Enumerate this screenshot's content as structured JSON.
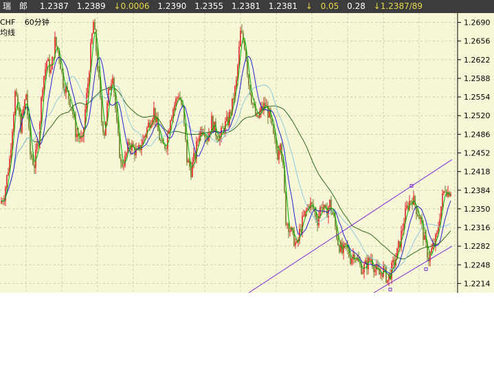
{
  "quote_bar": {
    "symbol": "瑞　郎",
    "last": "1.2387",
    "ask": "1.2389",
    "change": "↓0.0006",
    "open": "1.2390",
    "low": "1.2355",
    "high": "1.2381",
    "prev": "1.2381",
    "arrow": "↓",
    "volume": "0.05",
    "ratio": "0.28",
    "range_text": "↓1.2387/89"
  },
  "chart_header": {
    "symbol": "CHF",
    "period": "60分钟",
    "line_label": "均线"
  },
  "colors": {
    "background": "#f7f7d8",
    "grid": "#c9cfa5",
    "up_candle": "#e02020",
    "down_candle": "#6b7d1f",
    "ma_fast": "#00b000",
    "ma_mid": "#2020cc",
    "ma_light": "#8ec8dc",
    "ma_slow": "#2e6a1a",
    "channel": "#7a2ad8",
    "axis_text": "#000000"
  },
  "chart_data": {
    "type": "candlestick",
    "ylim": [
      1.2197,
      1.2707
    ],
    "y_ticks": [
      "1.2690",
      "1.2656",
      "1.2622",
      "1.2588",
      "1.2554",
      "1.2520",
      "1.2486",
      "1.2452",
      "1.2418",
      "1.2384",
      "1.2350",
      "1.2316",
      "1.2282",
      "1.2248",
      "1.2214"
    ],
    "close_path": [
      [
        0,
        1.236
      ],
      [
        6,
        1.2375
      ],
      [
        14,
        1.244
      ],
      [
        22,
        1.256
      ],
      [
        30,
        1.25
      ],
      [
        38,
        1.256
      ],
      [
        44,
        1.245
      ],
      [
        50,
        1.243
      ],
      [
        56,
        1.248
      ],
      [
        62,
        1.258
      ],
      [
        68,
        1.262
      ],
      [
        74,
        1.26
      ],
      [
        80,
        1.2655
      ],
      [
        86,
        1.263
      ],
      [
        92,
        1.258
      ],
      [
        98,
        1.256
      ],
      [
        104,
        1.254
      ],
      [
        110,
        1.249
      ],
      [
        116,
        1.248
      ],
      [
        120,
        1.247
      ],
      [
        124,
        1.253
      ],
      [
        128,
        1.258
      ],
      [
        132,
        1.264
      ],
      [
        136,
        1.269
      ],
      [
        140,
        1.264
      ],
      [
        144,
        1.258
      ],
      [
        148,
        1.251
      ],
      [
        152,
        1.249
      ],
      [
        158,
        1.256
      ],
      [
        164,
        1.26
      ],
      [
        170,
        1.25
      ],
      [
        176,
        1.243
      ],
      [
        182,
        1.244
      ],
      [
        188,
        1.247
      ],
      [
        194,
        1.246
      ],
      [
        200,
        1.245
      ],
      [
        206,
        1.247
      ],
      [
        212,
        1.249
      ],
      [
        218,
        1.251
      ],
      [
        224,
        1.253
      ],
      [
        230,
        1.249
      ],
      [
        236,
        1.246
      ],
      [
        242,
        1.247
      ],
      [
        248,
        1.252
      ],
      [
        254,
        1.254
      ],
      [
        260,
        1.256
      ],
      [
        266,
        1.253
      ],
      [
        272,
        1.244
      ],
      [
        278,
        1.242
      ],
      [
        284,
        1.245
      ],
      [
        290,
        1.249
      ],
      [
        296,
        1.25
      ],
      [
        302,
        1.248
      ],
      [
        308,
        1.251
      ],
      [
        314,
        1.249
      ],
      [
        320,
        1.248
      ],
      [
        326,
        1.25
      ],
      [
        332,
        1.251
      ],
      [
        338,
        1.254
      ],
      [
        344,
        1.258
      ],
      [
        350,
        1.267
      ],
      [
        356,
        1.265
      ],
      [
        362,
        1.258
      ],
      [
        368,
        1.254
      ],
      [
        374,
        1.251
      ],
      [
        380,
        1.253
      ],
      [
        386,
        1.254
      ],
      [
        392,
        1.252
      ],
      [
        398,
        1.248
      ],
      [
        404,
        1.245
      ],
      [
        408,
        1.248
      ],
      [
        412,
        1.242
      ],
      [
        416,
        1.233
      ],
      [
        420,
        1.232
      ],
      [
        426,
        1.23
      ],
      [
        432,
        1.228
      ],
      [
        438,
        1.232
      ],
      [
        444,
        1.234
      ],
      [
        450,
        1.236
      ],
      [
        456,
        1.235
      ],
      [
        462,
        1.233
      ],
      [
        468,
        1.236
      ],
      [
        474,
        1.234
      ],
      [
        480,
        1.236
      ],
      [
        486,
        1.233
      ],
      [
        492,
        1.229
      ],
      [
        498,
        1.227
      ],
      [
        504,
        1.228
      ],
      [
        510,
        1.226
      ],
      [
        516,
        1.227
      ],
      [
        522,
        1.225
      ],
      [
        528,
        1.224
      ],
      [
        534,
        1.225
      ],
      [
        540,
        1.226
      ],
      [
        546,
        1.224
      ],
      [
        552,
        1.223
      ],
      [
        558,
        1.224
      ],
      [
        564,
        1.222
      ],
      [
        570,
        1.224
      ],
      [
        576,
        1.226
      ],
      [
        582,
        1.229
      ],
      [
        588,
        1.233
      ],
      [
        594,
        1.236
      ],
      [
        600,
        1.237
      ],
      [
        606,
        1.235
      ],
      [
        612,
        1.233
      ],
      [
        618,
        1.229
      ],
      [
        624,
        1.226
      ],
      [
        630,
        1.228
      ],
      [
        636,
        1.23
      ],
      [
        640,
        1.234
      ],
      [
        644,
        1.237
      ],
      [
        648,
        1.239
      ],
      [
        652,
        1.238
      ],
      [
        656,
        1.2385
      ]
    ],
    "channel_upper": [
      [
        362,
        1.2197
      ],
      [
        658,
        1.244
      ]
    ],
    "channel_lower": [
      [
        544,
        1.2197
      ],
      [
        658,
        1.2282
      ]
    ]
  }
}
